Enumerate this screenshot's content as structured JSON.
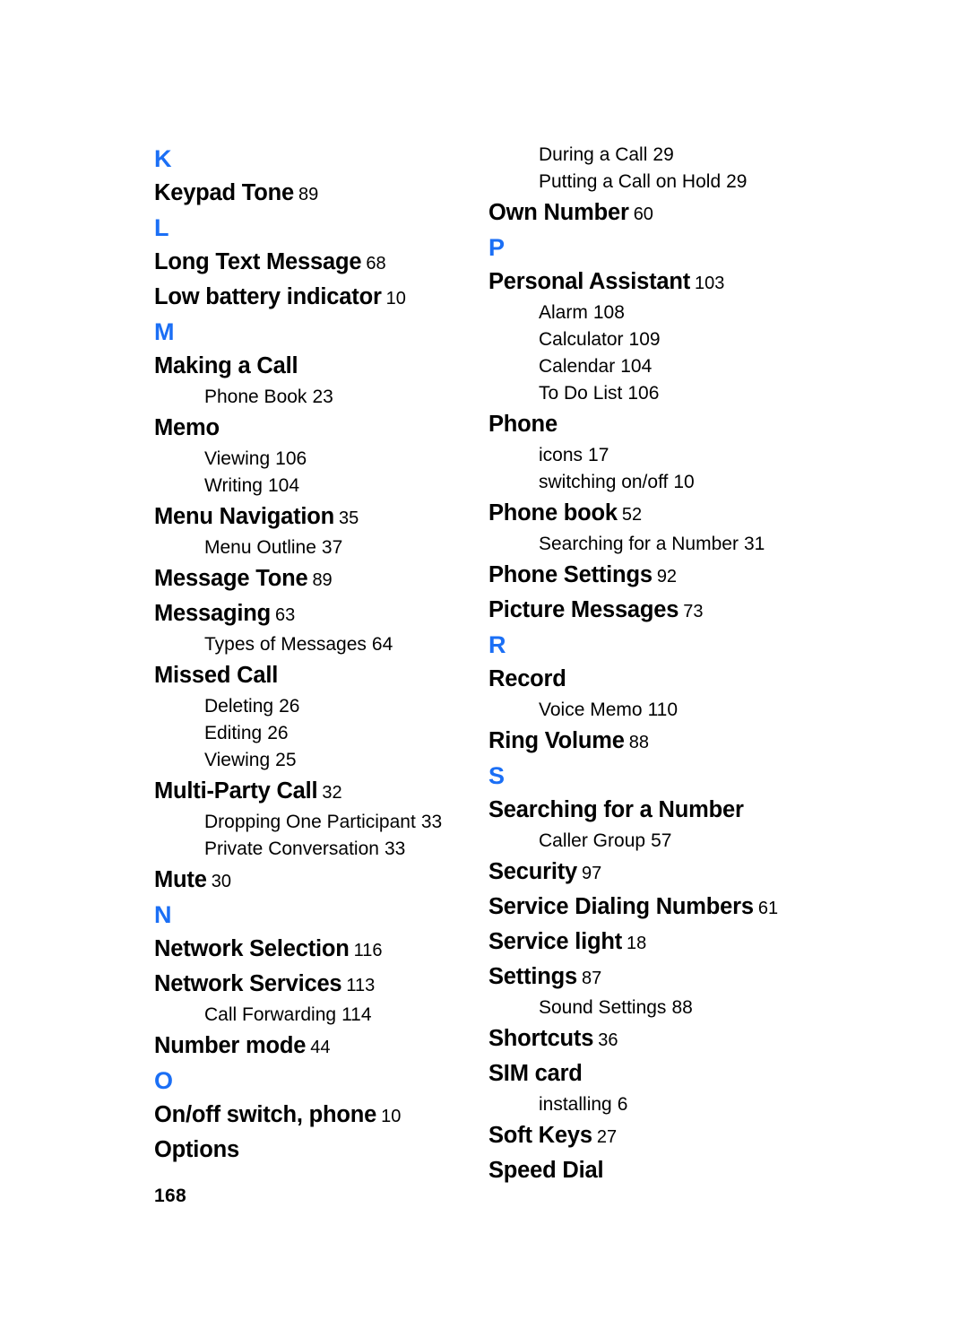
{
  "document": {
    "page_number": "168",
    "accent_color": "#1b6ff5",
    "text_color": "#000000",
    "background_color": "#ffffff"
  },
  "columns": [
    {
      "id": "left",
      "blocks": [
        {
          "kind": "letter",
          "label": "K"
        },
        {
          "kind": "entry",
          "title": "Keypad Tone",
          "page": "89"
        },
        {
          "kind": "letter",
          "label": "L"
        },
        {
          "kind": "entry",
          "title": "Long Text Message",
          "page": "68"
        },
        {
          "kind": "entry",
          "title": "Low battery indicator",
          "page": "10"
        },
        {
          "kind": "letter",
          "label": "M"
        },
        {
          "kind": "entry",
          "title": "Making a Call",
          "page": ""
        },
        {
          "kind": "sub",
          "title": "Phone Book",
          "page": "23"
        },
        {
          "kind": "entry",
          "title": "Memo",
          "page": ""
        },
        {
          "kind": "sub",
          "title": "Viewing",
          "page": "106"
        },
        {
          "kind": "sub",
          "title": "Writing",
          "page": "104"
        },
        {
          "kind": "entry",
          "title": "Menu Navigation",
          "page": "35"
        },
        {
          "kind": "sub",
          "title": "Menu Outline",
          "page": "37"
        },
        {
          "kind": "entry",
          "title": "Message Tone",
          "page": "89"
        },
        {
          "kind": "entry",
          "title": "Messaging",
          "page": "63"
        },
        {
          "kind": "sub",
          "title": "Types of Messages",
          "page": "64"
        },
        {
          "kind": "entry",
          "title": "Missed Call",
          "page": ""
        },
        {
          "kind": "sub",
          "title": "Deleting",
          "page": "26"
        },
        {
          "kind": "sub",
          "title": "Editing",
          "page": "26"
        },
        {
          "kind": "sub",
          "title": "Viewing",
          "page": "25"
        },
        {
          "kind": "entry",
          "title": "Multi-Party Call",
          "page": "32"
        },
        {
          "kind": "sub",
          "title": "Dropping One Participant",
          "page": "33"
        },
        {
          "kind": "sub",
          "title": "Private Conversation",
          "page": "33"
        },
        {
          "kind": "entry",
          "title": "Mute",
          "page": "30"
        },
        {
          "kind": "letter",
          "label": "N"
        },
        {
          "kind": "entry",
          "title": "Network Selection",
          "page": "116"
        },
        {
          "kind": "entry",
          "title": "Network Services",
          "page": "113"
        },
        {
          "kind": "sub",
          "title": "Call Forwarding",
          "page": "114"
        },
        {
          "kind": "entry",
          "title": "Number mode",
          "page": "44"
        },
        {
          "kind": "letter",
          "label": "O"
        },
        {
          "kind": "entry",
          "title": "On/off switch, phone",
          "page": "10"
        },
        {
          "kind": "entry",
          "title": "Options",
          "page": ""
        }
      ]
    },
    {
      "id": "right",
      "blocks": [
        {
          "kind": "sub",
          "title": "During a Call",
          "page": "29"
        },
        {
          "kind": "sub",
          "title": "Putting a Call on Hold",
          "page": "29"
        },
        {
          "kind": "entry",
          "title": "Own Number",
          "page": "60"
        },
        {
          "kind": "letter",
          "label": "P"
        },
        {
          "kind": "entry",
          "title": "Personal Assistant",
          "page": "103"
        },
        {
          "kind": "sub",
          "title": "Alarm",
          "page": "108"
        },
        {
          "kind": "sub",
          "title": "Calculator",
          "page": "109"
        },
        {
          "kind": "sub",
          "title": "Calendar",
          "page": "104"
        },
        {
          "kind": "sub",
          "title": "To Do List",
          "page": "106"
        },
        {
          "kind": "entry",
          "title": "Phone",
          "page": ""
        },
        {
          "kind": "sub",
          "title": "icons",
          "page": "17"
        },
        {
          "kind": "sub",
          "title": "switching on/off",
          "page": "10"
        },
        {
          "kind": "entry",
          "title": "Phone book",
          "page": "52"
        },
        {
          "kind": "sub",
          "title": "Searching for a Number",
          "page": "31"
        },
        {
          "kind": "entry",
          "title": "Phone Settings",
          "page": "92"
        },
        {
          "kind": "entry",
          "title": "Picture Messages",
          "page": "73"
        },
        {
          "kind": "letter",
          "label": "R"
        },
        {
          "kind": "entry",
          "title": "Record",
          "page": ""
        },
        {
          "kind": "sub",
          "title": "Voice Memo",
          "page": "110"
        },
        {
          "kind": "entry",
          "title": "Ring Volume",
          "page": "88"
        },
        {
          "kind": "letter",
          "label": "S"
        },
        {
          "kind": "entry",
          "title": "Searching for a Number",
          "page": ""
        },
        {
          "kind": "sub",
          "title": "Caller Group",
          "page": "57"
        },
        {
          "kind": "entry",
          "title": "Security",
          "page": "97"
        },
        {
          "kind": "entry",
          "title": "Service Dialing Numbers",
          "page": "61"
        },
        {
          "kind": "entry",
          "title": "Service light",
          "page": "18"
        },
        {
          "kind": "entry",
          "title": "Settings",
          "page": "87"
        },
        {
          "kind": "sub",
          "title": "Sound Settings",
          "page": "88"
        },
        {
          "kind": "entry",
          "title": "Shortcuts",
          "page": "36"
        },
        {
          "kind": "entry",
          "title": "SIM card",
          "page": ""
        },
        {
          "kind": "sub",
          "title": "installing",
          "page": "6"
        },
        {
          "kind": "entry",
          "title": "Soft Keys",
          "page": "27"
        },
        {
          "kind": "entry",
          "title": "Speed Dial",
          "page": ""
        }
      ]
    }
  ]
}
